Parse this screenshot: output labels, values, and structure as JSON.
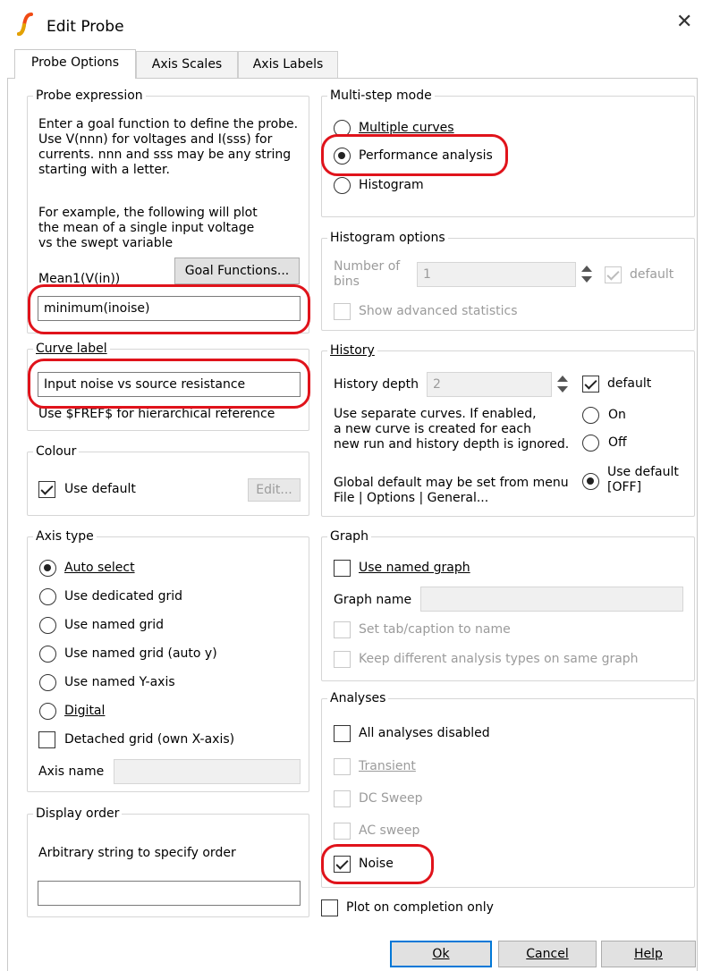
{
  "window": {
    "title": "Edit Probe"
  },
  "tabs": [
    "Probe Options",
    "Axis Scales",
    "Axis Labels"
  ],
  "probe_expression": {
    "title": "Probe expression",
    "line1": "Enter a goal function to define the probe.",
    "line2": "Use V(nnn) for voltages and I(sss) for",
    "line3": "currents. nnn and sss may be any string",
    "line4": "starting with a letter.",
    "example1": "For example, the following will plot",
    "example2": "the mean of a single input voltage",
    "example3": "vs the swept variable",
    "example_expr": "Mean1(V(in))",
    "goal_button": "Goal Functions...",
    "value": "minimum(inoise)"
  },
  "curve_label": {
    "title": "Curve label",
    "value": "Input noise vs source resistance",
    "hint": "Use $FREF$ for hierarchical reference"
  },
  "colour": {
    "title": "Colour",
    "use_default": "Use default",
    "edit_button": "Edit..."
  },
  "axis_type": {
    "title": "Axis type",
    "options": [
      "Auto select",
      "Use dedicated grid",
      "Use named grid",
      "Use named grid (auto y)",
      "Use named Y-axis",
      "Digital"
    ],
    "detached": "Detached grid (own X-axis)",
    "axis_name_label": "Axis name"
  },
  "display_order": {
    "title": "Display order",
    "hint": "Arbitrary string to specify order"
  },
  "multi_step": {
    "title": "Multi-step mode",
    "options": [
      "Multiple curves",
      "Performance analysis",
      "Histogram"
    ]
  },
  "histogram": {
    "title": "Histogram options",
    "bins_label_1": "Number of",
    "bins_label_2": "bins",
    "bins_value": "1",
    "default_label": "default",
    "advanced": "Show advanced statistics"
  },
  "history": {
    "title": "History",
    "depth_label": "History depth",
    "depth_value": "2",
    "default_label": "default",
    "sep1": "Use separate curves. If enabled,",
    "sep2": "a new curve is created for each",
    "sep3": "new run and history depth is ignored.",
    "on": "On",
    "off": "Off",
    "global1": "Global default may be set from menu",
    "global2": "File | Options | General...",
    "use_default_1": "Use default",
    "use_default_2": "[OFF]"
  },
  "graph": {
    "title": "Graph",
    "use_named": "Use named graph",
    "graph_name_label": "Graph name",
    "set_tab": "Set tab/caption to name",
    "keep_diff": "Keep different analysis types on same graph"
  },
  "analyses": {
    "title": "Analyses",
    "all_disabled": "All analyses disabled",
    "items": [
      "Transient",
      "DC Sweep",
      "AC sweep",
      "Noise"
    ]
  },
  "plot_on_completion": "Plot on completion only",
  "buttons": {
    "ok": "Ok",
    "cancel": "Cancel",
    "help": "Help"
  },
  "colors": {
    "highlight": "#e0131b",
    "default_button_border": "#0078d7"
  }
}
